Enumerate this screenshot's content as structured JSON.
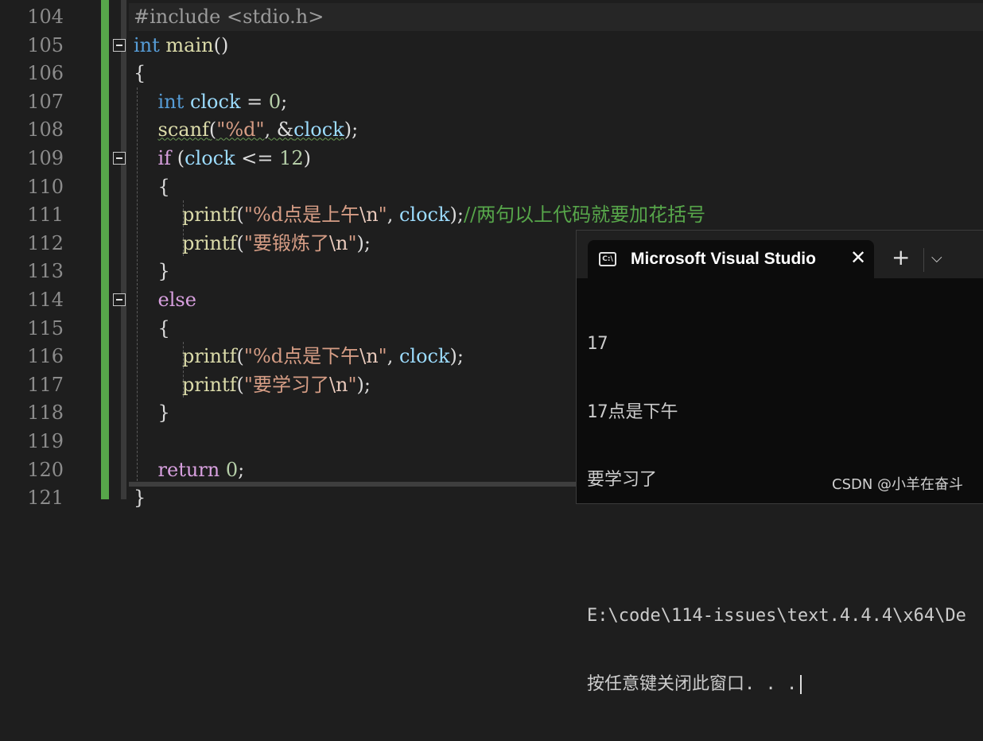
{
  "editor": {
    "line_numbers": [
      "104",
      "105",
      "106",
      "107",
      "108",
      "109",
      "110",
      "111",
      "112",
      "113",
      "114",
      "115",
      "116",
      "117",
      "118",
      "119",
      "120",
      "121"
    ],
    "lines": {
      "l104": {
        "a": "#include ",
        "b": "<stdio.h>"
      },
      "l105": {
        "kw": "int",
        "sp": " ",
        "fn": "main",
        "rest": "()"
      },
      "l106": {
        "text": "{"
      },
      "l107": {
        "indent": "    ",
        "kw": "int",
        "sp": " ",
        "var": "clock",
        "op": " = ",
        "num": "0",
        "end": ";"
      },
      "l108": {
        "indent": "    ",
        "fn": "scanf",
        "p1": "(",
        "str": "\"%d\"",
        "p2": ", &",
        "var": "clock",
        "end": ");"
      },
      "l109": {
        "indent": "    ",
        "kw": "if",
        "p1": " (",
        "var": "clock",
        "op": " <= ",
        "num": "12",
        "end": ")"
      },
      "l110": {
        "indent": "    ",
        "text": "{"
      },
      "l111": {
        "indent": "        ",
        "fn": "printf",
        "p1": "(",
        "str1": "\"%d点是上午",
        "esc": "\\n",
        "str2": "\"",
        "p2": ", ",
        "var": "clock",
        "end": ");",
        "comment": "//两句以上代码就要加花括号"
      },
      "l112": {
        "indent": "        ",
        "fn": "printf",
        "p1": "(",
        "str1": "\"要锻炼了",
        "esc": "\\n",
        "str2": "\"",
        "end": ");"
      },
      "l113": {
        "indent": "    ",
        "text": "}"
      },
      "l114": {
        "indent": "    ",
        "kw": "else"
      },
      "l115": {
        "indent": "    ",
        "text": "{"
      },
      "l116": {
        "indent": "        ",
        "fn": "printf",
        "p1": "(",
        "str1": "\"%d点是下午",
        "esc": "\\n",
        "str2": "\"",
        "p2": ", ",
        "var": "clock",
        "end": ");"
      },
      "l117": {
        "indent": "        ",
        "fn": "printf",
        "p1": "(",
        "str1": "\"要学习了",
        "esc": "\\n",
        "str2": "\"",
        "end": ");"
      },
      "l118": {
        "indent": "    ",
        "text": "}"
      },
      "l119": {
        "text": ""
      },
      "l120": {
        "indent": "    ",
        "kw": "return",
        "sp": " ",
        "num": "0",
        "end": ";"
      },
      "l121": {
        "text": "}"
      }
    }
  },
  "console": {
    "tab_icon": "C:\\",
    "title": "Microsoft Visual Studio",
    "close_glyph": "✕",
    "new_tab_glyph": "+",
    "dropdown_glyph": "⌵",
    "output": [
      "17",
      "17点是下午",
      "要学习了",
      "",
      "E:\\code\\114-issues\\text.4.4.4\\x64\\De",
      "按任意键关闭此窗口. . ."
    ]
  },
  "watermark": "CSDN @小羊在奋斗",
  "colors": {
    "keyword": "#569cd6",
    "control": "#d8a0df",
    "function": "#dcdcaa",
    "variable": "#9cdcfe",
    "string": "#d69d85",
    "number": "#b5cea8",
    "comment": "#57a64a",
    "change_bar": "#57a64a"
  }
}
